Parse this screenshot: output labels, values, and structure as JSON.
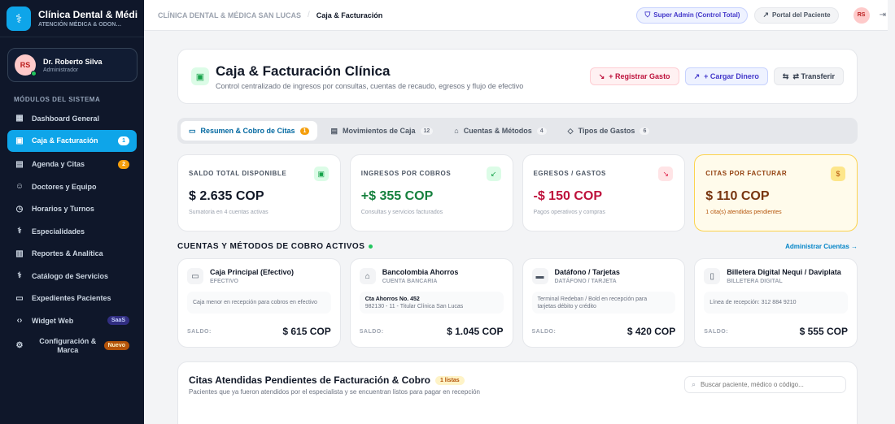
{
  "sidebar": {
    "brand_title": "Clínica Dental & Médic…",
    "brand_sub": "ATENCIÓN MÉDICA & ODON…",
    "user_name": "Dr. Roberto Silva",
    "user_role": "Administrador",
    "section_title": "MÓDULOS DEL SISTEMA",
    "items": [
      {
        "label": "Dashboard General",
        "icon": "grid-icon"
      },
      {
        "label": "Caja & Facturación",
        "icon": "cash-register-icon",
        "badge": "1"
      },
      {
        "label": "Agenda y Citas",
        "icon": "calendar-icon",
        "badge": "2"
      },
      {
        "label": "Doctores y Equipo",
        "icon": "users-icon"
      },
      {
        "label": "Horarios y Turnos",
        "icon": "clock-icon"
      },
      {
        "label": "Especialidades",
        "icon": "stethoscope-icon"
      },
      {
        "label": "Reportes & Analítica",
        "icon": "bar-chart-icon"
      },
      {
        "label": "Catálogo de Servicios",
        "icon": "stethoscope-icon"
      },
      {
        "label": "Expedientes Pacientes",
        "icon": "folder-icon"
      },
      {
        "label": "Widget Web",
        "icon": "code-icon",
        "badge": "SaaS"
      },
      {
        "label": "Configuración & Marca",
        "icon": "gear-icon",
        "badge": "Nuevo"
      }
    ]
  },
  "topbar": {
    "breadcrumb_clinic": "CLÍNICA DENTAL & MÉDICA SAN LUCAS",
    "breadcrumb_separator": "/",
    "breadcrumb_page": "Caja & Facturación",
    "admin_label": "Super Admin (Control Total)",
    "portal_label": "Portal del Paciente"
  },
  "header": {
    "title": "Caja & Facturación Clínica",
    "subtitle": "Control centralizado de ingresos por consultas, cuentas de recaudo, egresos y flujo de efectivo",
    "btn_gasto": "+ Registrar Gasto",
    "btn_cargar": "+ Cargar Dinero",
    "btn_transfer": "⇄ Transferir"
  },
  "tabs": [
    {
      "label": "Resumen & Cobro de Citas",
      "count": "1",
      "icon": "card-icon"
    },
    {
      "label": "Movimientos de Caja",
      "count": "12",
      "icon": "receipt-icon"
    },
    {
      "label": "Cuentas & Métodos",
      "count": "4",
      "icon": "bank-icon"
    },
    {
      "label": "Tipos de Gastos",
      "count": "6",
      "icon": "tag-icon"
    }
  ],
  "stats": [
    {
      "label": "SALDO TOTAL DISPONIBLE",
      "value": "$ 2.635 COP",
      "note": "Sumatoria en 4 cuentas activas",
      "color": "#111827",
      "icon_bg": "#dcfce7",
      "icon_color": "#16a34a"
    },
    {
      "label": "INGRESOS POR COBROS",
      "value": "+$ 355 COP",
      "note": "Consultas y servicios facturados",
      "color": "#15803d",
      "icon_bg": "#dcfce7",
      "icon_color": "#16a34a"
    },
    {
      "label": "EGRESOS / GASTOS",
      "value": "-$ 150 COP",
      "note": "Pagos operativos y compras",
      "color": "#be123c",
      "icon_bg": "#ffe4e6",
      "icon_color": "#e11d48"
    },
    {
      "label": "CITAS POR FACTURAR",
      "value": "$ 110 COP",
      "note": "1 cita(s) atendidas pendientes",
      "color": "#78350f",
      "icon_bg": "#fde68a",
      "icon_color": "#b45309"
    }
  ],
  "accounts_section": {
    "title": "CUENTAS Y MÉTODOS DE COBRO ACTIVOS",
    "link": "Administrar Cuentas →"
  },
  "accounts": [
    {
      "name": "Caja Principal (Efectivo)",
      "type": "EFECTIVO",
      "desc1": "Caja menor en recepción para cobros en efectivo",
      "desc2": "",
      "balance_label": "SALDO:",
      "balance": "$ 615 COP"
    },
    {
      "name": "Bancolombia Ahorros",
      "type": "CUENTA BANCARIA",
      "desc1": "Cta Ahorros No. 452",
      "desc2": "982130 - 11 - Titular Clínica San Lucas",
      "balance_label": "SALDO:",
      "balance": "$ 1.045 COP"
    },
    {
      "name": "Datáfono / Tarjetas",
      "type": "DATÁFONO / TARJETA",
      "desc1": "Terminal Redeban / Bold en recepción para",
      "desc2": "tarjetas débito y crédito",
      "balance_label": "SALDO:",
      "balance": "$ 420 COP"
    },
    {
      "name": "Billetera Digital Nequi / Daviplata",
      "type": "BILLETERA DIGITAL",
      "desc1": "Línea de recepción: 312 884 9210",
      "desc2": "",
      "balance_label": "SALDO:",
      "balance": "$ 555 COP"
    }
  ],
  "pending": {
    "title": "Citas Atendidas Pendientes de Facturación & Cobro",
    "badge": "1 listas",
    "subtitle": "Pacientes que ya fueron atendidos por el especialista y se encuentran listos para pagar en recepción",
    "search_placeholder": "Buscar paciente, médico o código..."
  }
}
